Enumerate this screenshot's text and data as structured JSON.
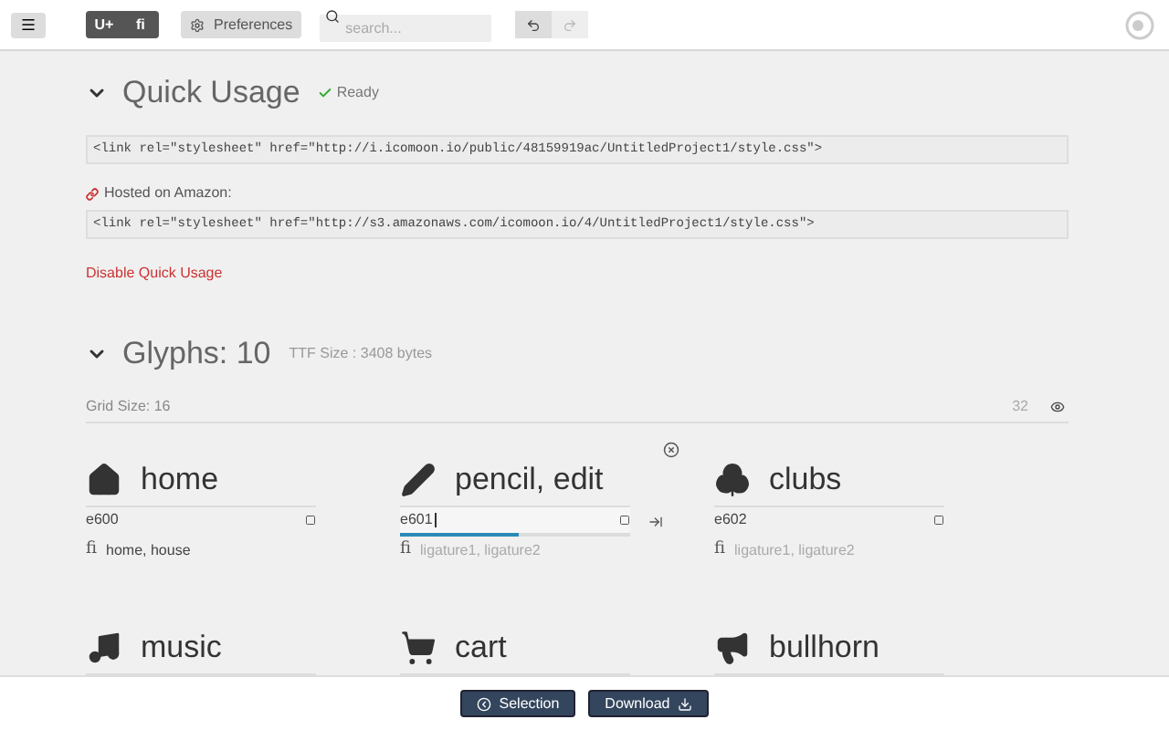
{
  "toolbar": {
    "toggles": [
      {
        "label": "U+",
        "selected": true
      },
      {
        "label": "ﬁ",
        "selected": true
      }
    ],
    "preferences": "Preferences",
    "search": {
      "placeholder": "search..."
    },
    "undo": {
      "disabled": false
    },
    "redo": {
      "disabled": true
    }
  },
  "quick_usage": {
    "title": "Quick Usage",
    "status": "Ready",
    "link": "<link rel=\"stylesheet\" href=\"http://i.icomoon.io/public/48159919ac/UntitledProject1/style.css\">",
    "hosted_label": "Hosted on Amazon:",
    "hosted_link": "<link rel=\"stylesheet\" href=\"http://s3.amazonaws.com/icomoon.io/4/UntitledProject1/style.css\">",
    "disable": "Disable Quick Usage"
  },
  "glyphs": {
    "title": "Glyphs: 10",
    "ttf_size": "TTF Size : 3408 bytes",
    "grid_size": "Grid Size: 16",
    "preview_size": "32",
    "items": [
      {
        "name": "home",
        "code": "e600",
        "focused": false,
        "ligatures": {
          "label": "ﬁ",
          "value": "home, house"
        }
      },
      {
        "name": "pencil, edit",
        "code": "e601",
        "focused": true,
        "ligatures": {
          "label": "ﬁ",
          "placeholder": "ligature1, ligature2"
        }
      },
      {
        "name": "clubs",
        "code": "e602",
        "focused": false,
        "ligatures": {
          "label": "ﬁ",
          "placeholder": "ligature1, ligature2"
        }
      },
      {
        "name": "music"
      },
      {
        "name": "cart"
      },
      {
        "name": "bullhorn"
      }
    ]
  },
  "footer": {
    "buttons": [
      "Selection",
      "Download"
    ]
  }
}
